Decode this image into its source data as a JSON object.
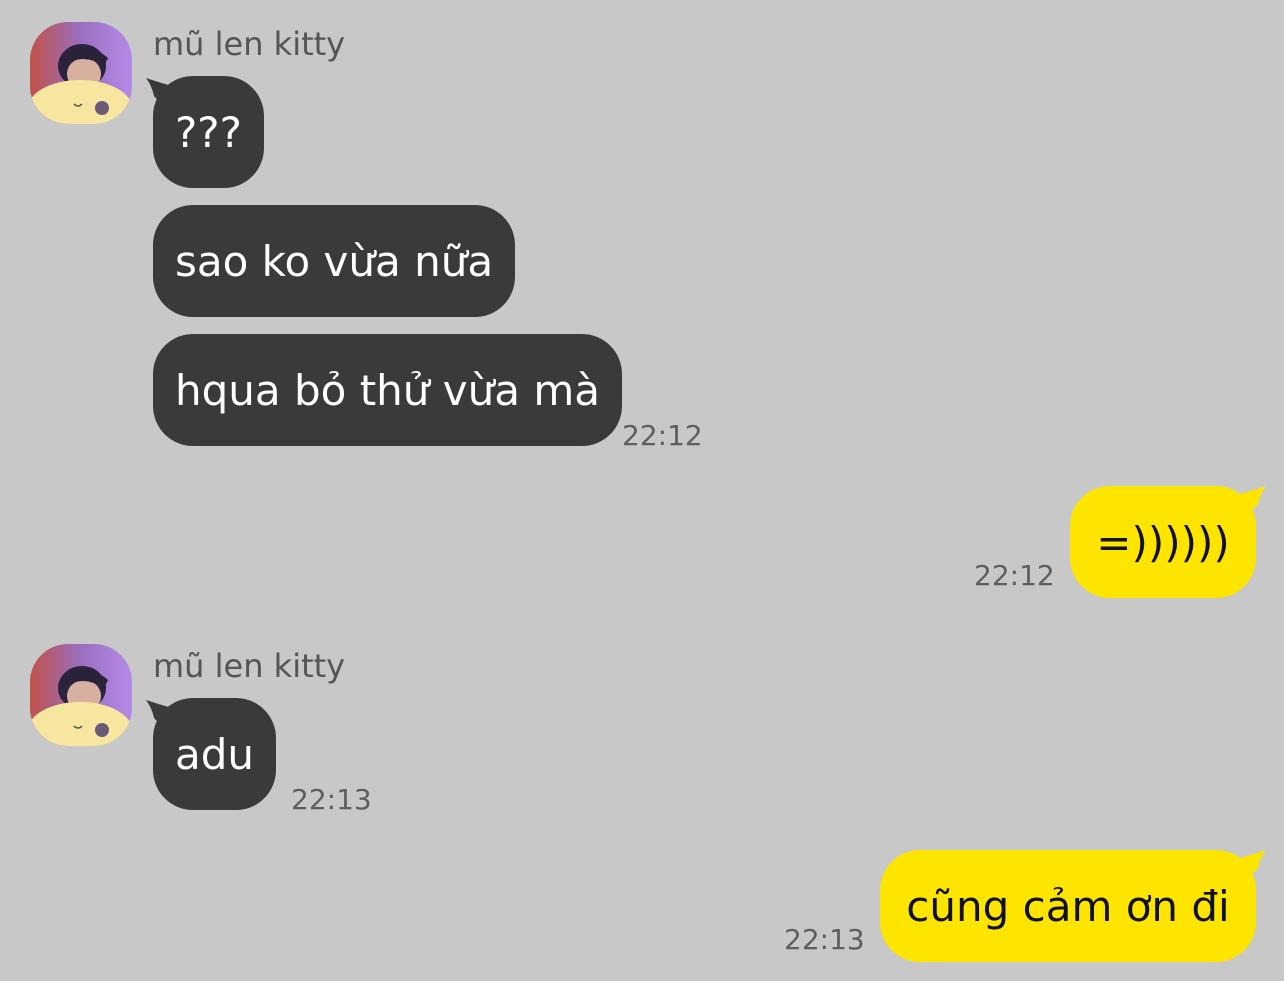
{
  "chat": {
    "groups": [
      {
        "sender": "mũ len kitty",
        "messages": [
          "???",
          "sao ko vừa nữa",
          "hqua bỏ thử vừa mà"
        ],
        "time": "22:12"
      },
      {
        "outgoing": "=))))))",
        "time": "22:12"
      },
      {
        "sender": "mũ len kitty",
        "messages": [
          "adu"
        ],
        "time": "22:13"
      },
      {
        "outgoing": "cũng cảm ơn đi",
        "time": "22:13"
      }
    ]
  },
  "colors": {
    "background": "#c8c8c8",
    "incoming_bubble": "#3a3a3c",
    "outgoing_bubble": "#fee500"
  },
  "icons": {
    "avatar": "profile-photo-avatar"
  }
}
